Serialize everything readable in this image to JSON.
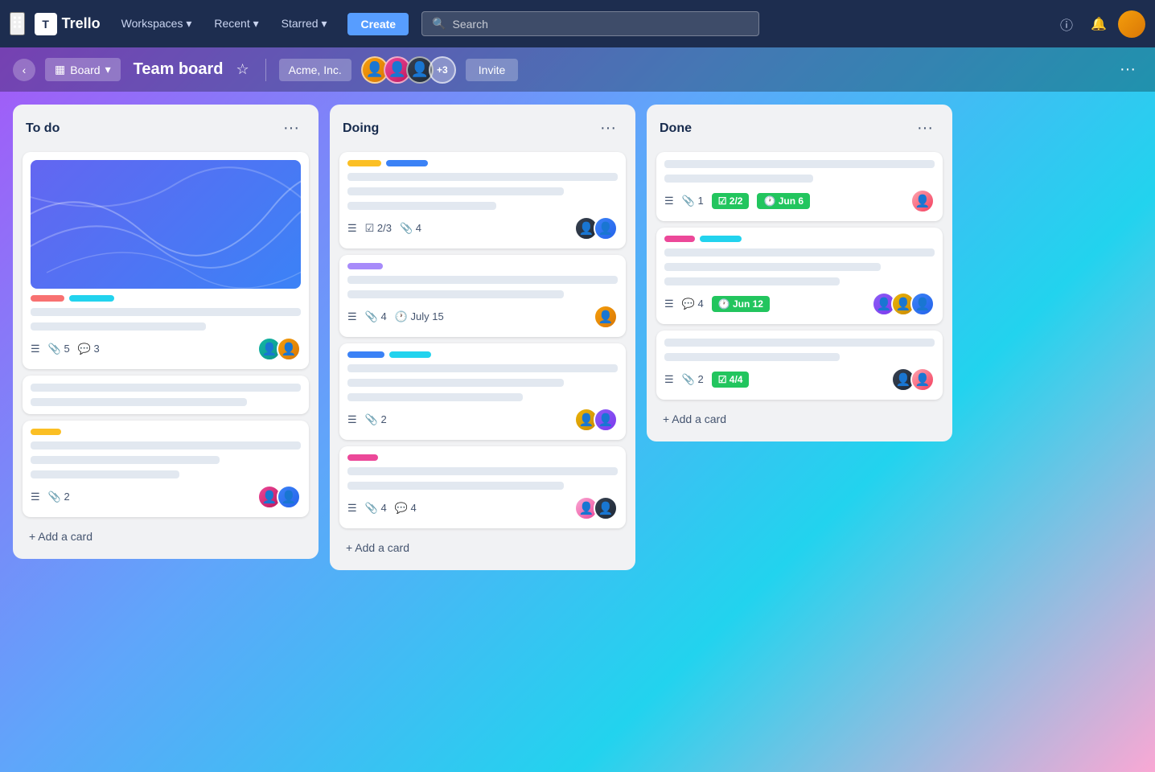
{
  "nav": {
    "logo_text": "Trello",
    "workspaces_label": "Workspaces ▾",
    "recent_label": "Recent ▾",
    "starred_label": "Starred ▾",
    "create_label": "Create",
    "search_placeholder": "Search",
    "info_icon": "ⓘ",
    "bell_icon": "🔔"
  },
  "board": {
    "view_label": "Board",
    "title": "Team board",
    "workspace_name": "Acme, Inc.",
    "member_count": "+3",
    "invite_label": "Invite",
    "more_icon": "···"
  },
  "lists": [
    {
      "id": "todo",
      "title": "To do",
      "cards": [
        {
          "id": "c1",
          "has_cover": true,
          "labels": [
            "pink",
            "cyan"
          ],
          "lines": [
            "w100",
            "w65"
          ],
          "meta": {
            "list": true,
            "attach": 5,
            "comment": 3
          },
          "avatars": [
            "teal",
            "amber"
          ]
        },
        {
          "id": "c2",
          "has_cover": false,
          "labels": [],
          "lines": [
            "w100",
            "w80"
          ],
          "meta": {},
          "avatars": []
        },
        {
          "id": "c3",
          "has_cover": false,
          "labels": [
            "yellow"
          ],
          "lines": [
            "w100",
            "w70",
            "w55"
          ],
          "meta": {
            "list": true,
            "attach": 2
          },
          "avatars": [
            "pink",
            "blue"
          ]
        }
      ],
      "add_label": "+ Add a card"
    },
    {
      "id": "doing",
      "title": "Doing",
      "cards": [
        {
          "id": "c4",
          "has_cover": false,
          "labels": [
            "yellow",
            "blue-doing"
          ],
          "lines": [
            "w100",
            "w80",
            "w55"
          ],
          "meta": {
            "list": true,
            "checklist": "2/3",
            "attach": 4
          },
          "avatars": [
            "dark",
            "blue"
          ]
        },
        {
          "id": "c5",
          "has_cover": false,
          "labels": [
            "purple"
          ],
          "lines": [
            "w100",
            "w80"
          ],
          "meta": {
            "list": true,
            "attach": 4,
            "due": "July 15"
          },
          "avatars": [
            "amber"
          ]
        },
        {
          "id": "c6",
          "has_cover": false,
          "labels": [
            "blue",
            "cyan"
          ],
          "lines": [
            "w100",
            "w80",
            "w65"
          ],
          "meta": {
            "list": true,
            "attach": 2
          },
          "avatars": [
            "yellow",
            "purple"
          ]
        },
        {
          "id": "c7",
          "has_cover": false,
          "labels": [
            "magenta"
          ],
          "lines": [
            "w100",
            "w80"
          ],
          "meta": {
            "list": true,
            "attach": 4,
            "comment": 4
          },
          "avatars": [
            "pink",
            "dark"
          ]
        }
      ],
      "add_label": "+ Add a card"
    },
    {
      "id": "done",
      "title": "Done",
      "cards": [
        {
          "id": "c8",
          "has_cover": false,
          "labels": [],
          "lines": [
            "w100",
            "w55"
          ],
          "meta": {
            "list": true,
            "attach": 1,
            "checklist": "2/2",
            "due": "Jun 6"
          },
          "avatars": [
            "pink-light"
          ]
        },
        {
          "id": "c9",
          "has_cover": false,
          "labels": [
            "magenta",
            "cyan"
          ],
          "lines": [
            "w100",
            "w80",
            "w65"
          ],
          "meta": {
            "list": true,
            "comment": 4,
            "due": "Jun 12"
          },
          "avatars": [
            "purple",
            "yellow",
            "blue"
          ]
        },
        {
          "id": "c10",
          "has_cover": false,
          "labels": [],
          "lines": [
            "w100",
            "w65"
          ],
          "meta": {
            "list": true,
            "attach": 2,
            "checklist": "4/4"
          },
          "avatars": [
            "dark",
            "pink-light2"
          ]
        }
      ],
      "add_label": "+ Add a card"
    }
  ]
}
